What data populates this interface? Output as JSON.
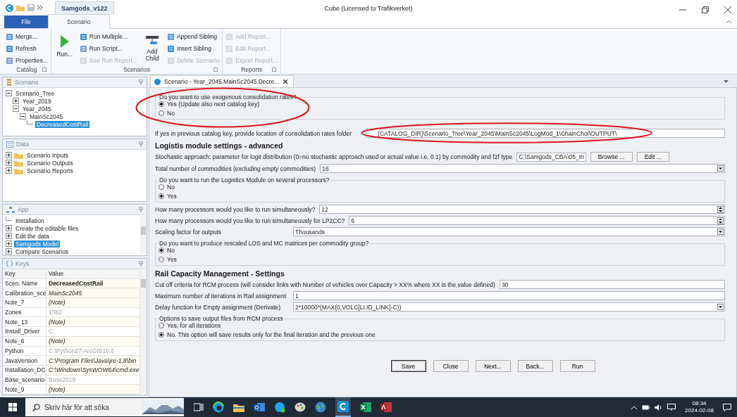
{
  "window": {
    "document_tab": "Samgods_v122",
    "title": "Cube (Licensed to Trafikverket)"
  },
  "ribbon": {
    "file_tab": "File",
    "tabs": [
      {
        "label": "Scenario",
        "selected": true
      }
    ],
    "groups": [
      {
        "label": "Catalog",
        "items": [
          {
            "label": "Merge...",
            "kind": "small",
            "disabled": false
          },
          {
            "label": "Refresh",
            "kind": "small",
            "disabled": false
          },
          {
            "label": "Properties...",
            "kind": "small",
            "disabled": false
          }
        ]
      },
      {
        "label": "Scenarios",
        "items": [
          {
            "label": "Run...",
            "kind": "play",
            "disabled": false
          },
          {
            "label": "Run Multiple...",
            "kind": "small",
            "disabled": false
          },
          {
            "label": "Run Script...",
            "kind": "small",
            "disabled": false
          },
          {
            "label": "See Run Report...",
            "kind": "small",
            "disabled": true
          },
          {
            "label": "Add Child",
            "kind": "child",
            "disabled": false
          },
          {
            "label": "Append Sibling",
            "kind": "small",
            "disabled": false
          },
          {
            "label": "Insert Sibling",
            "kind": "small",
            "disabled": false
          },
          {
            "label": "Delete Scenario",
            "kind": "small",
            "disabled": true
          }
        ]
      },
      {
        "label": "Reports",
        "items": [
          {
            "label": "Add Report...",
            "kind": "small",
            "disabled": true
          },
          {
            "label": "Edit Report...",
            "kind": "small",
            "disabled": true
          },
          {
            "label": "Export Report...",
            "kind": "small",
            "disabled": true
          }
        ]
      }
    ]
  },
  "scenario_panel": {
    "title": "Scenario",
    "tree": [
      {
        "label": "Scenario_Tree",
        "expanded": true,
        "selected": false,
        "children": [
          {
            "label": "Year_2019",
            "expanded": false,
            "selected": false
          },
          {
            "label": "Year_2045",
            "expanded": true,
            "selected": false,
            "children": [
              {
                "label": "MainSc2045",
                "expanded": true,
                "selected": false,
                "children": [
                  {
                    "label": "DecreasedCostRail",
                    "selected": true
                  }
                ]
              }
            ]
          }
        ]
      }
    ]
  },
  "data_panel": {
    "title": "Data",
    "items": [
      {
        "label": "Scenario Inputs",
        "expanded": false
      },
      {
        "label": "Scenario Outputs",
        "expanded": false
      },
      {
        "label": "Scenario Reports",
        "expanded": false
      }
    ]
  },
  "app_panel": {
    "title": "App",
    "items": [
      {
        "label": "Installation",
        "selected": false
      },
      {
        "label": "Create the editable files",
        "expanded": false,
        "selected": false
      },
      {
        "label": "Edit the data",
        "expanded": false,
        "selected": false
      },
      {
        "label": "Samgods Model",
        "expanded": false,
        "selected": true
      },
      {
        "label": "Compare Scenarios",
        "expanded": false,
        "selected": false
      }
    ]
  },
  "keys_panel": {
    "title": "Keys",
    "columns": [
      "Key",
      "Value"
    ],
    "rows": [
      {
        "key": "Scen. Name",
        "value": "DecreasedCostRail",
        "kind": "bold"
      },
      {
        "key": "Calibration_sce",
        "value": "MainSc2045",
        "kind": "italic"
      },
      {
        "key": "Note_7",
        "value": "(Note)",
        "kind": "italic"
      },
      {
        "key": "Zones",
        "value": "1382",
        "kind": "readonly"
      },
      {
        "key": "Note_13",
        "value": "(Note)",
        "kind": "italic"
      },
      {
        "key": "Install_Driver",
        "value": "C:",
        "kind": "readonly"
      },
      {
        "key": "Note_6",
        "value": "(Note)",
        "kind": "italic"
      },
      {
        "key": "Python",
        "value": "C:\\Python27\\ArcGIS10.6",
        "kind": "readonly"
      },
      {
        "key": "JavaVersion",
        "value": "C:\\Program Files\\Java\\jre-1.8\\bin",
        "kind": "italic"
      },
      {
        "key": "Installation_DC",
        "value": "C:\\Windows\\SysWOW64\\cmd.exe",
        "kind": "italic"
      },
      {
        "key": "Base_scenario",
        "value": "Base2019",
        "kind": "readonly"
      },
      {
        "key": "Note_9",
        "value": "(Note)",
        "kind": "italic"
      }
    ]
  },
  "document_tabs": [
    {
      "label": "Scenario - Year_2045.MainSc2045.Decre...",
      "selected": true
    }
  ],
  "form": {
    "items": [
      {
        "kind": "radio",
        "legend": "Do you want to use exogenous consolidation rates?",
        "highlighted": true,
        "options": [
          {
            "label": "Yes (Update also next catalog key)",
            "selected": true
          },
          {
            "label": "No",
            "selected": false
          }
        ]
      },
      {
        "kind": "text",
        "label": "If yes in previous catalog key, provide location of consolidation rates folder",
        "value": "{CATALOG_DIR}\\Scenario_Tree\\Year_2045\\MainSc2045\\LogMod_1\\ChainChoi\\OUTPUT\\",
        "highlighted": true
      },
      {
        "kind": "heading",
        "label": "Logistis module settings - advanced"
      },
      {
        "kind": "file",
        "label": "Stochastic approach: parameter for logit distribution (0=no stochastic approach used or actual value i.e. 0.1) by commodity and f2f type",
        "value": "C:\\Samgods_CBA\\05_In",
        "buttons": [
          "Browse ...",
          "Edit ..."
        ]
      },
      {
        "kind": "dropdown",
        "label": "Total number of commodities (excluding empty commodities)",
        "value": "16"
      },
      {
        "kind": "radio",
        "legend": "Do you want to run the Logistics Module on several processors?",
        "options": [
          {
            "label": "No",
            "selected": false
          },
          {
            "label": "Yes",
            "selected": true
          }
        ]
      },
      {
        "kind": "spin",
        "label": "How many processors would you like to run simultaneously?",
        "value": "12"
      },
      {
        "kind": "spin",
        "label": "How many processors would you like to run simultaneously for LP2CC?",
        "value": "6"
      },
      {
        "kind": "dropdown",
        "label": "Scaling factor for outputs",
        "value": "Thousands"
      },
      {
        "kind": "radio",
        "legend": "Do you want to produce rescaled LOS and MC matrices per commodity group?",
        "options": [
          {
            "label": "No",
            "selected": true
          },
          {
            "label": "Yes",
            "selected": false
          }
        ]
      },
      {
        "kind": "heading",
        "label": "Rail Capacity Management - Settings"
      },
      {
        "kind": "text",
        "label": "Cut off criteria for RCM process (will consider links with Number of vehicles over Capacity > XX% where XX is the value defined)",
        "value": "30"
      },
      {
        "kind": "text",
        "label": "Maximum number of iterations in Rail assignment",
        "value": "1"
      },
      {
        "kind": "dropdown",
        "label": "Delay function for Empty assignment (Derivate)",
        "value": "2*10000*(MAX(0,VOLC[LI.ID_LINK]-C))"
      },
      {
        "kind": "radio",
        "legend": "Options to save output files from RCM process",
        "options": [
          {
            "label": "Yes, for all iterations",
            "selected": false
          },
          {
            "label": "No. This option will save results only for the final iteration and the previous one",
            "selected": true
          }
        ]
      }
    ],
    "buttons": [
      {
        "label": "Save",
        "focused": true
      },
      {
        "label": "Close",
        "focused": false
      },
      {
        "label": "Next...",
        "focused": false
      },
      {
        "label": "Back...",
        "focused": false
      },
      {
        "label": "Run",
        "focused": false
      }
    ]
  },
  "taskbar": {
    "search_placeholder": "Skriv här för att söka",
    "time": "08:34",
    "date": "2024-02-08"
  }
}
